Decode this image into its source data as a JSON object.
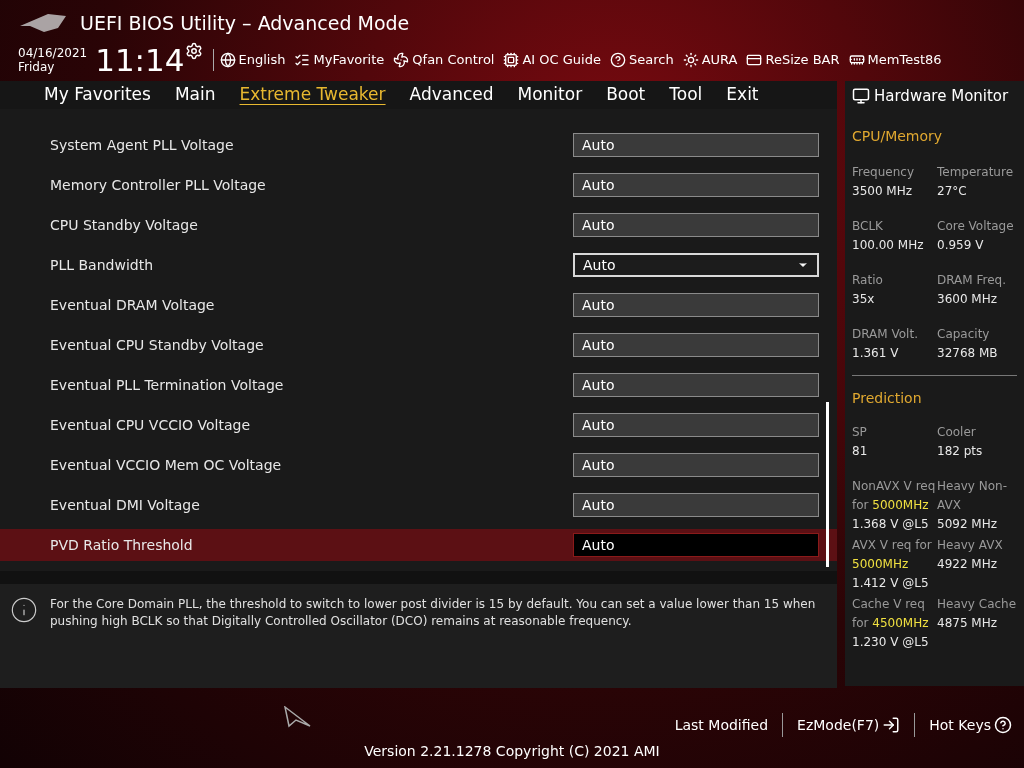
{
  "header": {
    "title": "UEFI BIOS Utility – Advanced Mode",
    "date": "04/16/2021",
    "day": "Friday",
    "time": "11:14"
  },
  "toolbar": [
    {
      "kind": "globe",
      "label": "English"
    },
    {
      "kind": "list",
      "label": "MyFavorite"
    },
    {
      "kind": "fan",
      "label": "Qfan Control"
    },
    {
      "kind": "chip",
      "label": "AI OC Guide"
    },
    {
      "kind": "help",
      "label": "Search"
    },
    {
      "kind": "light",
      "label": "AURA"
    },
    {
      "kind": "card",
      "label": "ReSize BAR"
    },
    {
      "kind": "memory",
      "label": "MemTest86"
    }
  ],
  "tabs": [
    {
      "label": "My Favorites",
      "selected": false
    },
    {
      "label": "Main",
      "selected": false
    },
    {
      "label": "Extreme Tweaker",
      "selected": true
    },
    {
      "label": "Advanced",
      "selected": false
    },
    {
      "label": "Monitor",
      "selected": false
    },
    {
      "label": "Boot",
      "selected": false
    },
    {
      "label": "Tool",
      "selected": false
    },
    {
      "label": "Exit",
      "selected": false
    }
  ],
  "settings": [
    {
      "label": "System Agent PLL Voltage",
      "value": "Auto",
      "kind": "field",
      "selected": false
    },
    {
      "label": "Memory Controller PLL Voltage",
      "value": "Auto",
      "kind": "field",
      "selected": false
    },
    {
      "label": "CPU Standby Voltage",
      "value": "Auto",
      "kind": "field",
      "selected": false
    },
    {
      "label": "PLL Bandwidth",
      "value": "Auto",
      "kind": "dropdown",
      "selected": false
    },
    {
      "label": "Eventual DRAM Voltage",
      "value": "Auto",
      "kind": "field",
      "selected": false
    },
    {
      "label": "Eventual CPU Standby Voltage",
      "value": "Auto",
      "kind": "field",
      "selected": false
    },
    {
      "label": "Eventual PLL Termination Voltage",
      "value": "Auto",
      "kind": "field",
      "selected": false
    },
    {
      "label": "Eventual CPU VCCIO Voltage",
      "value": "Auto",
      "kind": "field",
      "selected": false
    },
    {
      "label": "Eventual VCCIO Mem OC Voltage",
      "value": "Auto",
      "kind": "field",
      "selected": false
    },
    {
      "label": "Eventual DMI Voltage",
      "value": "Auto",
      "kind": "field",
      "selected": false
    },
    {
      "label": "PVD Ratio Threshold",
      "value": "Auto",
      "kind": "field",
      "selected": true
    }
  ],
  "help_text": "For the Core Domain PLL, the threshold to switch to lower post divider is 15 by default. You can set a value lower than 15 when pushing high BCLK so that Digitally Controlled Oscillator (DCO) remains at reasonable frequency.",
  "hardware_monitor": {
    "title": "Hardware Monitor",
    "cpu_memory": {
      "heading": "CPU/Memory",
      "items": [
        {
          "label": "Frequency",
          "value": "3500 MHz"
        },
        {
          "label": "Temperature",
          "value": "27°C"
        },
        {
          "label": "BCLK",
          "value": "100.00 MHz"
        },
        {
          "label": "Core Voltage",
          "value": "0.959 V"
        },
        {
          "label": "Ratio",
          "value": "35x"
        },
        {
          "label": "DRAM Freq.",
          "value": "3600 MHz"
        },
        {
          "label": "DRAM Volt.",
          "value": "1.361 V"
        },
        {
          "label": "Capacity",
          "value": "32768 MB"
        }
      ]
    },
    "prediction": {
      "heading": "Prediction",
      "items": [
        {
          "label": "SP",
          "value": "81"
        },
        {
          "label": "Cooler",
          "value": "182 pts"
        },
        {
          "label": "NonAVX V req for **5000MHz**",
          "value": "1.368 V @L5"
        },
        {
          "label": "Heavy Non-AVX",
          "value": "5092 MHz"
        },
        {
          "label": "AVX V req for **5000MHz**",
          "value": "1.412 V @L5"
        },
        {
          "label": "Heavy AVX",
          "value": "4922 MHz"
        },
        {
          "label": "Cache V req for **4500MHz**",
          "value": "1.230 V @L5"
        },
        {
          "label": "Heavy Cache",
          "value": "4875 MHz"
        }
      ]
    }
  },
  "footer": {
    "buttons": [
      {
        "kind": "text",
        "label": "Last Modified"
      },
      {
        "kind": "exit",
        "label": "EzMode(F7)"
      },
      {
        "kind": "help",
        "label": "Hot Keys"
      }
    ],
    "version": "Version 2.21.1278 Copyright (C) 2021 AMI"
  }
}
